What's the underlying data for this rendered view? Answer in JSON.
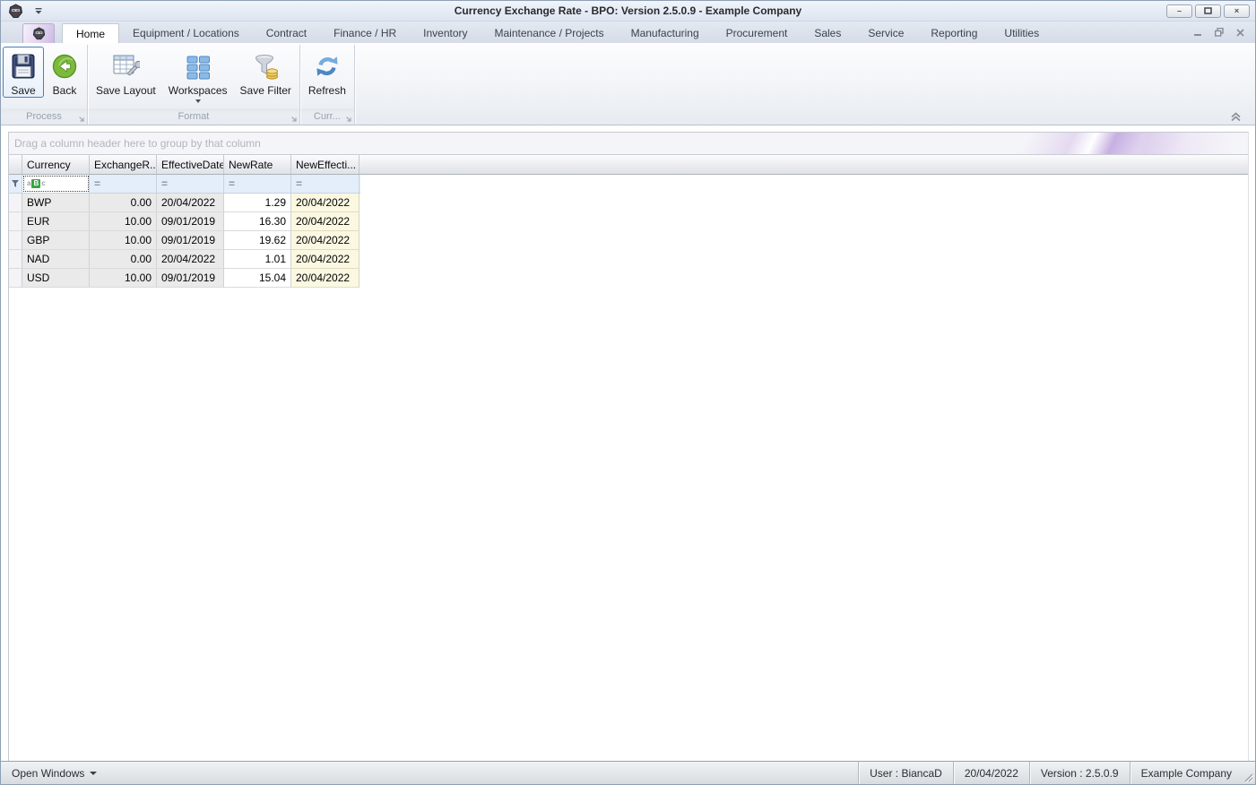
{
  "window": {
    "title": "Currency Exchange Rate - BPO: Version 2.5.0.9 - Example Company",
    "controls": {
      "minimize": "–",
      "close": "×"
    }
  },
  "ribbon": {
    "tabs": [
      "Home",
      "Equipment / Locations",
      "Contract",
      "Finance / HR",
      "Inventory",
      "Maintenance / Projects",
      "Manufacturing",
      "Procurement",
      "Sales",
      "Service",
      "Reporting",
      "Utilities"
    ],
    "selected_tab": "Home",
    "groups": [
      {
        "caption": "Process",
        "buttons": [
          {
            "label": "Save",
            "icon": "save-floppy-icon",
            "selected": true
          },
          {
            "label": "Back",
            "icon": "back-arrow-icon",
            "selected": false
          }
        ]
      },
      {
        "caption": "Format",
        "buttons": [
          {
            "label": "Save Layout",
            "icon": "save-layout-icon"
          },
          {
            "label": "Workspaces",
            "icon": "workspaces-icon",
            "dropdown": true
          },
          {
            "label": "Save Filter",
            "icon": "save-filter-icon"
          }
        ]
      },
      {
        "caption": "Curr...",
        "buttons": [
          {
            "label": "Refresh",
            "icon": "refresh-icon"
          }
        ]
      }
    ]
  },
  "grid": {
    "group_panel_text": "Drag a column header here to group by that column",
    "columns": [
      {
        "label": "Currency"
      },
      {
        "label": "ExchangeR..."
      },
      {
        "label": "EffectiveDate"
      },
      {
        "label": "NewRate"
      },
      {
        "label": "NewEffecti..."
      }
    ],
    "filter_operator": "=",
    "rows": [
      {
        "currency": "BWP",
        "exchange_rate": "0.00",
        "effective_date": "20/04/2022",
        "new_rate": "1.29",
        "new_effective_date": "20/04/2022"
      },
      {
        "currency": "EUR",
        "exchange_rate": "10.00",
        "effective_date": "09/01/2019",
        "new_rate": "16.30",
        "new_effective_date": "20/04/2022"
      },
      {
        "currency": "GBP",
        "exchange_rate": "10.00",
        "effective_date": "09/01/2019",
        "new_rate": "19.62",
        "new_effective_date": "20/04/2022"
      },
      {
        "currency": "NAD",
        "exchange_rate": "0.00",
        "effective_date": "20/04/2022",
        "new_rate": "1.01",
        "new_effective_date": "20/04/2022"
      },
      {
        "currency": "USD",
        "exchange_rate": "10.00",
        "effective_date": "09/01/2019",
        "new_rate": "15.04",
        "new_effective_date": "20/04/2022"
      }
    ]
  },
  "status_bar": {
    "open_windows": "Open Windows",
    "user": "User : BiancaD",
    "date": "20/04/2022",
    "version": "Version : 2.5.0.9",
    "company": "Example Company"
  },
  "colors": {
    "accent_selection": "#4a7ebb",
    "filter_row_bg": "#e4eefa",
    "readonly_cell_bg": "#eaeaea",
    "editable_cell_bg": "#ffffff",
    "highlight_cell_bg": "#fbf8e2",
    "workspaces_blue": "#7fb2e5",
    "back_green": "#76b832"
  }
}
